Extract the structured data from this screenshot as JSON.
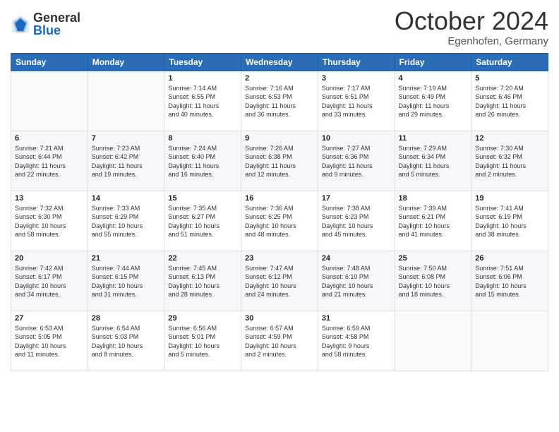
{
  "header": {
    "logo_general": "General",
    "logo_blue": "Blue",
    "month_title": "October 2024",
    "location": "Egenhofen, Germany"
  },
  "weekdays": [
    "Sunday",
    "Monday",
    "Tuesday",
    "Wednesday",
    "Thursday",
    "Friday",
    "Saturday"
  ],
  "weeks": [
    [
      {
        "day": "",
        "detail": ""
      },
      {
        "day": "",
        "detail": ""
      },
      {
        "day": "1",
        "detail": "Sunrise: 7:14 AM\nSunset: 6:55 PM\nDaylight: 11 hours\nand 40 minutes."
      },
      {
        "day": "2",
        "detail": "Sunrise: 7:16 AM\nSunset: 6:53 PM\nDaylight: 11 hours\nand 36 minutes."
      },
      {
        "day": "3",
        "detail": "Sunrise: 7:17 AM\nSunset: 6:51 PM\nDaylight: 11 hours\nand 33 minutes."
      },
      {
        "day": "4",
        "detail": "Sunrise: 7:19 AM\nSunset: 6:49 PM\nDaylight: 11 hours\nand 29 minutes."
      },
      {
        "day": "5",
        "detail": "Sunrise: 7:20 AM\nSunset: 6:46 PM\nDaylight: 11 hours\nand 26 minutes."
      }
    ],
    [
      {
        "day": "6",
        "detail": "Sunrise: 7:21 AM\nSunset: 6:44 PM\nDaylight: 11 hours\nand 22 minutes."
      },
      {
        "day": "7",
        "detail": "Sunrise: 7:23 AM\nSunset: 6:42 PM\nDaylight: 11 hours\nand 19 minutes."
      },
      {
        "day": "8",
        "detail": "Sunrise: 7:24 AM\nSunset: 6:40 PM\nDaylight: 11 hours\nand 16 minutes."
      },
      {
        "day": "9",
        "detail": "Sunrise: 7:26 AM\nSunset: 6:38 PM\nDaylight: 11 hours\nand 12 minutes."
      },
      {
        "day": "10",
        "detail": "Sunrise: 7:27 AM\nSunset: 6:36 PM\nDaylight: 11 hours\nand 9 minutes."
      },
      {
        "day": "11",
        "detail": "Sunrise: 7:29 AM\nSunset: 6:34 PM\nDaylight: 11 hours\nand 5 minutes."
      },
      {
        "day": "12",
        "detail": "Sunrise: 7:30 AM\nSunset: 6:32 PM\nDaylight: 11 hours\nand 2 minutes."
      }
    ],
    [
      {
        "day": "13",
        "detail": "Sunrise: 7:32 AM\nSunset: 6:30 PM\nDaylight: 10 hours\nand 58 minutes."
      },
      {
        "day": "14",
        "detail": "Sunrise: 7:33 AM\nSunset: 6:29 PM\nDaylight: 10 hours\nand 55 minutes."
      },
      {
        "day": "15",
        "detail": "Sunrise: 7:35 AM\nSunset: 6:27 PM\nDaylight: 10 hours\nand 51 minutes."
      },
      {
        "day": "16",
        "detail": "Sunrise: 7:36 AM\nSunset: 6:25 PM\nDaylight: 10 hours\nand 48 minutes."
      },
      {
        "day": "17",
        "detail": "Sunrise: 7:38 AM\nSunset: 6:23 PM\nDaylight: 10 hours\nand 45 minutes."
      },
      {
        "day": "18",
        "detail": "Sunrise: 7:39 AM\nSunset: 6:21 PM\nDaylight: 10 hours\nand 41 minutes."
      },
      {
        "day": "19",
        "detail": "Sunrise: 7:41 AM\nSunset: 6:19 PM\nDaylight: 10 hours\nand 38 minutes."
      }
    ],
    [
      {
        "day": "20",
        "detail": "Sunrise: 7:42 AM\nSunset: 6:17 PM\nDaylight: 10 hours\nand 34 minutes."
      },
      {
        "day": "21",
        "detail": "Sunrise: 7:44 AM\nSunset: 6:15 PM\nDaylight: 10 hours\nand 31 minutes."
      },
      {
        "day": "22",
        "detail": "Sunrise: 7:45 AM\nSunset: 6:13 PM\nDaylight: 10 hours\nand 28 minutes."
      },
      {
        "day": "23",
        "detail": "Sunrise: 7:47 AM\nSunset: 6:12 PM\nDaylight: 10 hours\nand 24 minutes."
      },
      {
        "day": "24",
        "detail": "Sunrise: 7:48 AM\nSunset: 6:10 PM\nDaylight: 10 hours\nand 21 minutes."
      },
      {
        "day": "25",
        "detail": "Sunrise: 7:50 AM\nSunset: 6:08 PM\nDaylight: 10 hours\nand 18 minutes."
      },
      {
        "day": "26",
        "detail": "Sunrise: 7:51 AM\nSunset: 6:06 PM\nDaylight: 10 hours\nand 15 minutes."
      }
    ],
    [
      {
        "day": "27",
        "detail": "Sunrise: 6:53 AM\nSunset: 5:05 PM\nDaylight: 10 hours\nand 11 minutes."
      },
      {
        "day": "28",
        "detail": "Sunrise: 6:54 AM\nSunset: 5:03 PM\nDaylight: 10 hours\nand 8 minutes."
      },
      {
        "day": "29",
        "detail": "Sunrise: 6:56 AM\nSunset: 5:01 PM\nDaylight: 10 hours\nand 5 minutes."
      },
      {
        "day": "30",
        "detail": "Sunrise: 6:57 AM\nSunset: 4:59 PM\nDaylight: 10 hours\nand 2 minutes."
      },
      {
        "day": "31",
        "detail": "Sunrise: 6:59 AM\nSunset: 4:58 PM\nDaylight: 9 hours\nand 58 minutes."
      },
      {
        "day": "",
        "detail": ""
      },
      {
        "day": "",
        "detail": ""
      }
    ]
  ]
}
